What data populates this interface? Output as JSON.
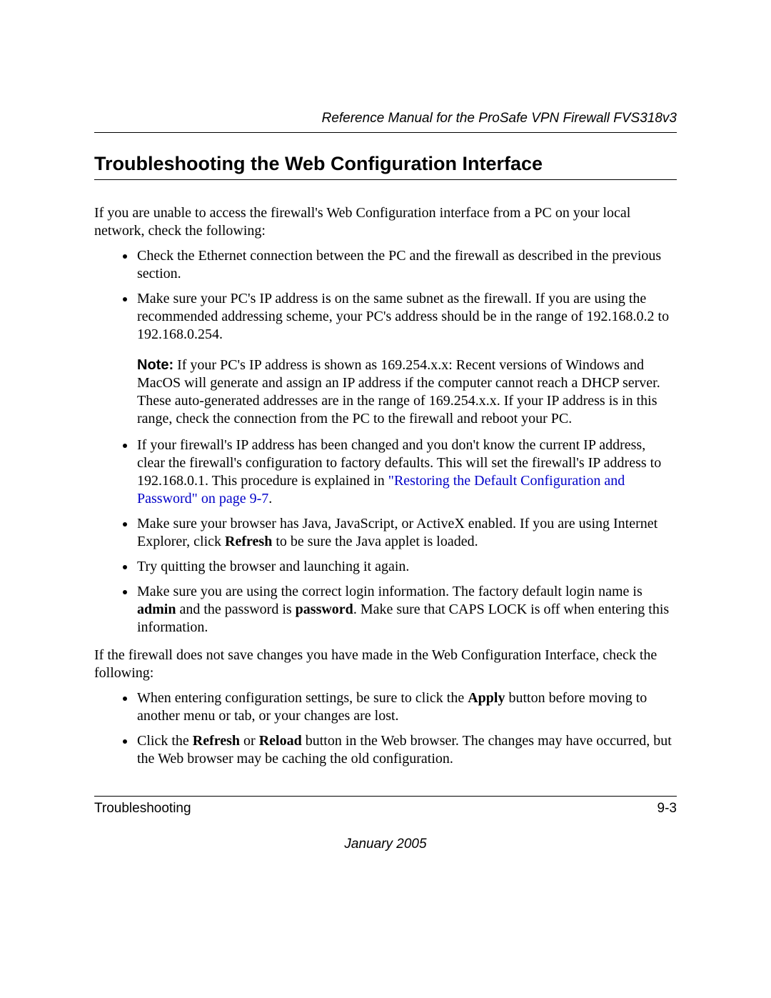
{
  "header": {
    "running_title": "Reference Manual for the ProSafe VPN Firewall FVS318v3"
  },
  "section": {
    "heading": "Troubleshooting the Web Configuration Interface",
    "intro": "If you are unable to access the firewall's Web Configuration interface from a PC on your local network, check the following:",
    "bullets_a": {
      "b1": "Check the Ethernet connection between the PC and the firewall as described in the previous section.",
      "b2": "Make sure your PC's IP address is on the same subnet as the firewall. If you are using the recommended addressing scheme, your PC's address should be in the range of 192.168.0.2 to 192.168.0.254.",
      "b2_note_label": "Note:",
      "b2_note_text": " If your PC's IP address is shown as 169.254.x.x: Recent versions of Windows and MacOS will generate and assign an IP address if the computer cannot reach a DHCP server. These auto-generated addresses are in the range of 169.254.x.x. If your IP address is in this range, check the connection from the PC to the firewall and reboot your PC.",
      "b3_pre": "If your firewall's IP address has been changed and you don't know the current IP address, clear the firewall's configuration to factory defaults. This will set the firewall's IP address to 192.168.0.1. This procedure is explained in ",
      "b3_link": "\"Restoring the Default Configuration and Password\" on page 9-7",
      "b3_post": ".",
      "b4_pre": "Make sure your browser has Java, JavaScript, or ActiveX enabled. If you are using Internet Explorer, click ",
      "b4_bold": "Refresh",
      "b4_post": " to be sure the Java applet is loaded.",
      "b5": "Try quitting the browser and launching it again.",
      "b6_pre": "Make sure you are using the correct login information. The factory default login name is ",
      "b6_bold1": "admin",
      "b6_mid": " and the password is ",
      "b6_bold2": "password",
      "b6_post": ". Make sure that CAPS LOCK is off when entering this information."
    },
    "intro2": "If the firewall does not save changes you have made in the Web Configuration Interface, check the following:",
    "bullets_b": {
      "b1_pre": "When entering configuration settings, be sure to click the ",
      "b1_bold": "Apply",
      "b1_post": " button before moving to another menu or tab, or your changes are lost.",
      "b2_pre": "Click the ",
      "b2_bold1": "Refresh",
      "b2_mid": " or ",
      "b2_bold2": "Reload",
      "b2_post": " button in the Web browser. The changes may have occurred, but the Web browser may be caching the old configuration."
    }
  },
  "footer": {
    "section_name": "Troubleshooting",
    "page_num": "9-3",
    "date": "January 2005"
  }
}
